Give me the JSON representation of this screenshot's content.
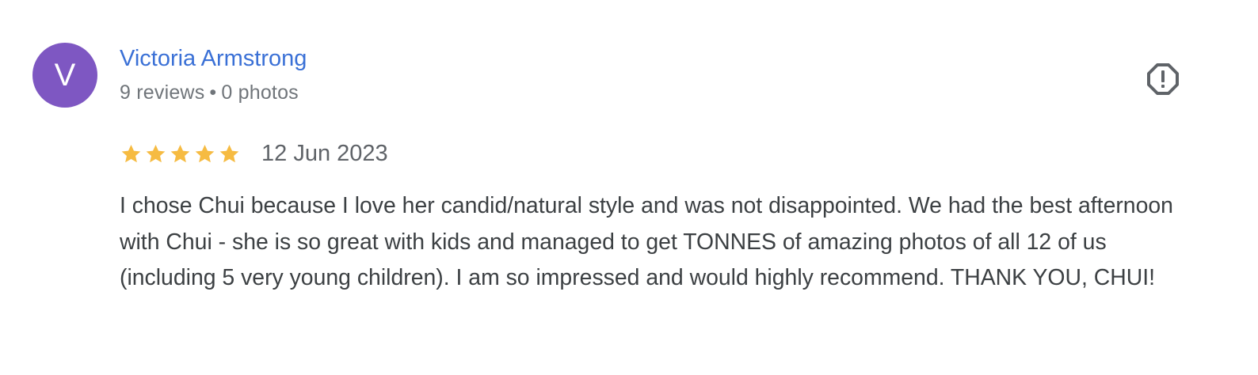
{
  "review": {
    "avatar_letter": "V",
    "avatar_color": "#7e57c2",
    "author": "Victoria Armstrong",
    "reviews_count": "9 reviews",
    "separator": "•",
    "photos_count": "0 photos",
    "rating": 5,
    "rating_max": 5,
    "star_icon": "star-icon",
    "star_color": "#f6bb42",
    "date": "12 Jun 2023",
    "text": "I chose Chui because I love her candid/natural style and was not disappointed. We had the best afternoon with Chui - she is so great with kids and managed to get TONNES of amazing photos of all 12 of us (including 5 very young children). I am so impressed and would highly recommend. THANK YOU, CHUI!",
    "flag_icon": "report-flag-icon"
  }
}
